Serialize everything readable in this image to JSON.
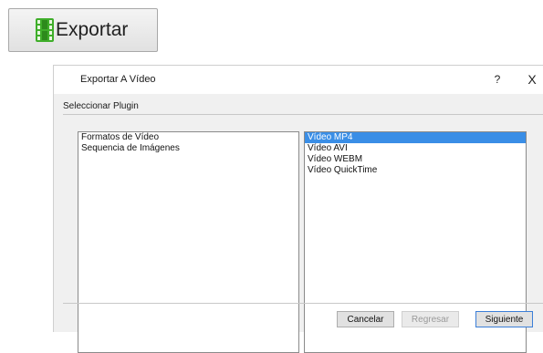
{
  "export_button": {
    "label": "Exportar",
    "icon": "film-icon",
    "icon_color": "#3fae2a"
  },
  "dialog": {
    "title": "Exportar A Vídeo",
    "help_label": "?",
    "close_label": "X",
    "section_title": "Seleccionar Plugin",
    "categories": [
      "Formatos de Vídeo",
      "Sequencia de Imágenes"
    ],
    "formats": [
      "Vídeo MP4",
      "Vídeo AVI",
      "Vídeo WEBM",
      "Vídeo QuickTime"
    ],
    "selected_format_index": 0,
    "buttons": {
      "cancel": "Cancelar",
      "back": "Regresar",
      "next": "Siguiente"
    },
    "selection_color": "#3a8ee6"
  }
}
